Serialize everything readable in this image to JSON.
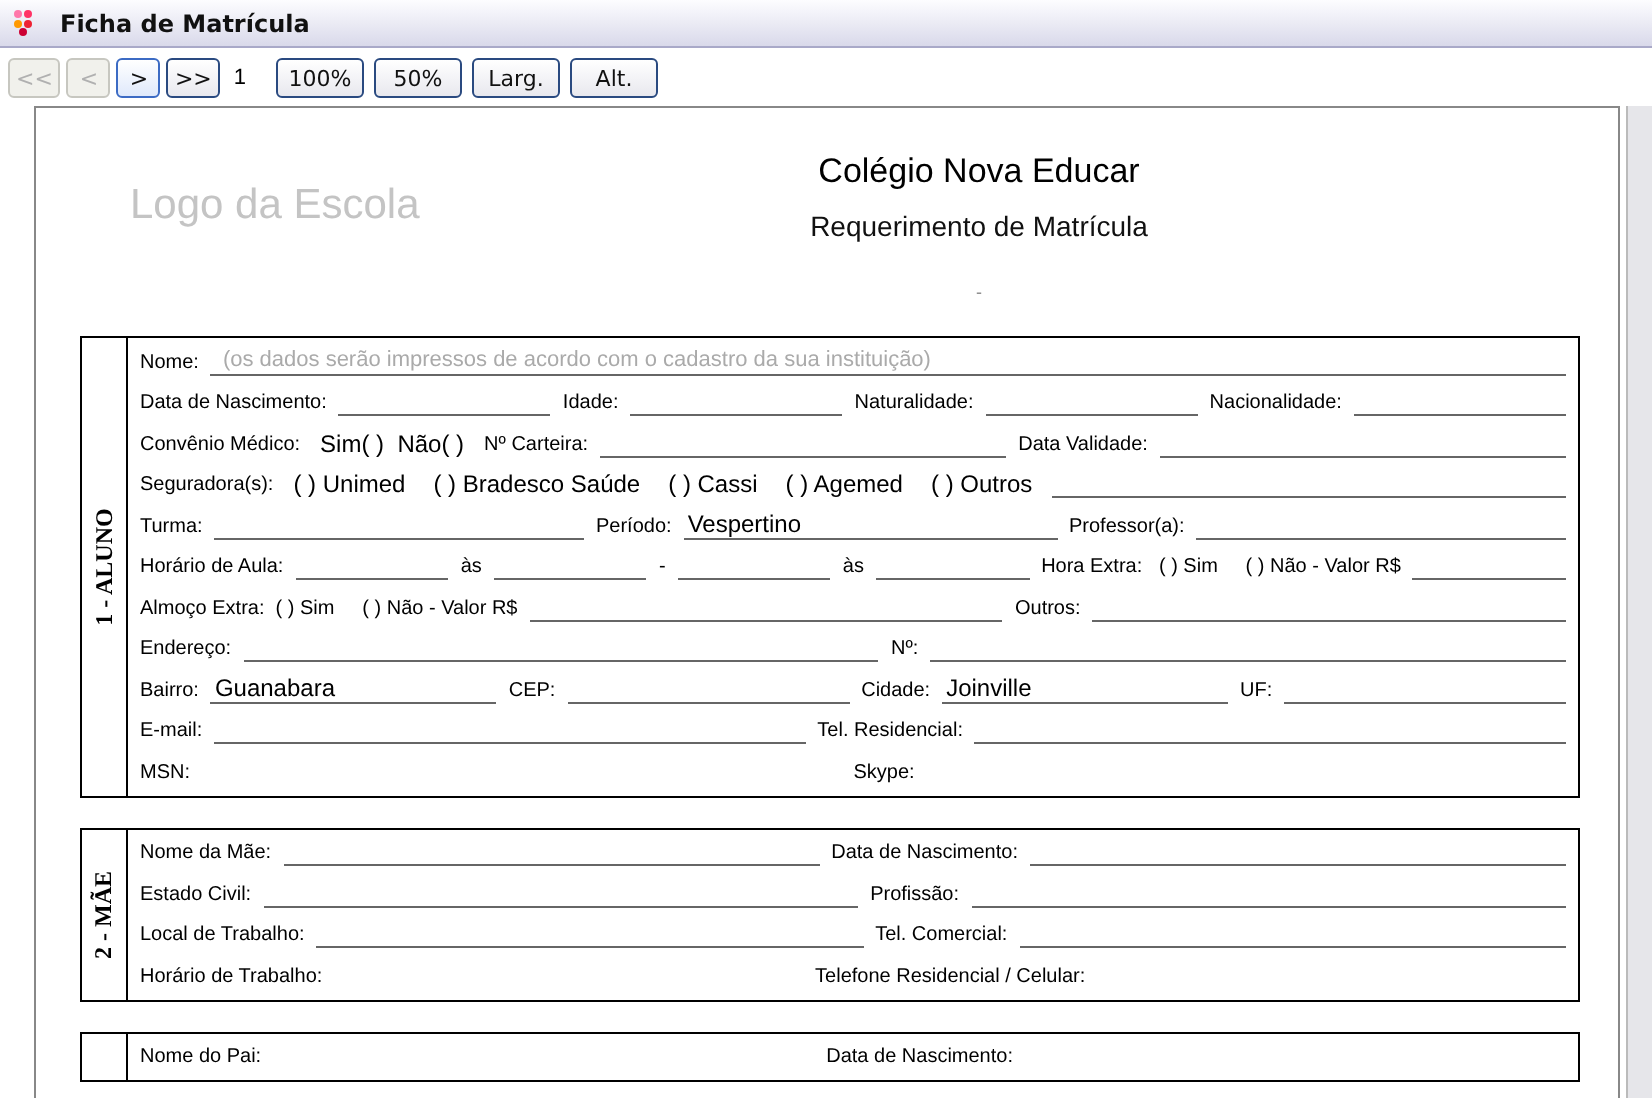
{
  "window": {
    "title": "Ficha de Matrícula"
  },
  "toolbar": {
    "nav_buttons": [
      {
        "label": "<<",
        "disabled": true
      },
      {
        "label": "<",
        "disabled": true
      },
      {
        "label": ">",
        "disabled": false,
        "selected": true
      },
      {
        "label": ">>",
        "disabled": false,
        "selected": false
      }
    ],
    "page": "1",
    "zoom_buttons": [
      "100%",
      "50%",
      "Larg.",
      "Alt."
    ]
  },
  "header": {
    "logo": "Logo da Escola",
    "school": "Colégio Nova Educar",
    "subtitle": "Requerimento de Matrícula",
    "mark": "-"
  },
  "sections": [
    {
      "title": "1 - ALUNO",
      "rows": [
        [
          {
            "kind": "label",
            "text": "Nome:"
          },
          {
            "kind": "hint",
            "text": "(os dados serão impressos de acordo com o cadastro da sua instituição)"
          }
        ],
        [
          {
            "kind": "label",
            "text": "Data de Nascimento:"
          },
          {
            "kind": "line"
          },
          {
            "kind": "label",
            "text": "Idade:"
          },
          {
            "kind": "line"
          },
          {
            "kind": "label",
            "text": "Naturalidade:"
          },
          {
            "kind": "line"
          },
          {
            "kind": "label",
            "text": "Nacionalidade:"
          },
          {
            "kind": "line"
          }
        ],
        [
          {
            "kind": "label",
            "text": "Convênio Médico:"
          },
          {
            "kind": "option",
            "text": "Sim( )  Não( )"
          },
          {
            "kind": "label",
            "text": "Nº Carteira:"
          },
          {
            "kind": "line"
          },
          {
            "kind": "label",
            "text": "Data Validade:"
          },
          {
            "kind": "line"
          }
        ],
        [
          {
            "kind": "label",
            "text": "Seguradora(s):"
          },
          {
            "kind": "option",
            "text": "( ) Unimed"
          },
          {
            "kind": "option",
            "text": "( ) Bradesco Saúde"
          },
          {
            "kind": "option",
            "text": "( ) Cassi"
          },
          {
            "kind": "option",
            "text": "( ) Agemed"
          },
          {
            "kind": "option",
            "text": "( ) Outros"
          },
          {
            "kind": "line"
          }
        ],
        [
          {
            "kind": "label",
            "text": "Turma:"
          },
          {
            "kind": "line"
          },
          {
            "kind": "label",
            "text": "Período:"
          },
          {
            "kind": "value",
            "text": "Vespertino"
          },
          {
            "kind": "label",
            "text": "Professor(a):"
          },
          {
            "kind": "line"
          }
        ],
        [
          {
            "kind": "label",
            "text": "Horário de Aula:"
          },
          {
            "kind": "line"
          },
          {
            "kind": "label",
            "text": "às"
          },
          {
            "kind": "line"
          },
          {
            "kind": "label",
            "text": "-"
          },
          {
            "kind": "line"
          },
          {
            "kind": "label",
            "text": "às"
          },
          {
            "kind": "line"
          },
          {
            "kind": "label",
            "text": "Hora Extra:   ( ) Sim     ( ) Não - Valor R$"
          },
          {
            "kind": "line"
          }
        ],
        [
          {
            "kind": "label",
            "text": "Almoço Extra:  ( ) Sim     ( ) Não - Valor R$"
          },
          {
            "kind": "line"
          },
          {
            "kind": "label",
            "text": "Outros:"
          },
          {
            "kind": "line"
          }
        ],
        [
          {
            "kind": "label",
            "text": "Endereço:"
          },
          {
            "kind": "line"
          },
          {
            "kind": "label",
            "text": "Nº:"
          },
          {
            "kind": "line"
          }
        ],
        [
          {
            "kind": "label",
            "text": "Bairro:"
          },
          {
            "kind": "value",
            "text": "Guanabara"
          },
          {
            "kind": "label",
            "text": "CEP:"
          },
          {
            "kind": "line"
          },
          {
            "kind": "label",
            "text": "Cidade:"
          },
          {
            "kind": "value",
            "text": "Joinville"
          },
          {
            "kind": "label",
            "text": "UF:"
          },
          {
            "kind": "line"
          }
        ],
        [
          {
            "kind": "label",
            "text": "E-mail:"
          },
          {
            "kind": "line"
          },
          {
            "kind": "label",
            "text": "Tel. Residencial:"
          },
          {
            "kind": "line"
          }
        ],
        [
          {
            "kind": "label",
            "text": "MSN:"
          },
          {
            "kind": "gap"
          },
          {
            "kind": "label",
            "text": "Skype:"
          },
          {
            "kind": "gap"
          }
        ]
      ]
    },
    {
      "title": "2 - MÃE",
      "rows": [
        [
          {
            "kind": "label",
            "text": "Nome da Mãe:"
          },
          {
            "kind": "line"
          },
          {
            "kind": "label",
            "text": "Data de Nascimento:"
          },
          {
            "kind": "line"
          }
        ],
        [
          {
            "kind": "label",
            "text": "Estado Civil:"
          },
          {
            "kind": "line"
          },
          {
            "kind": "label",
            "text": "Profissão:"
          },
          {
            "kind": "line"
          }
        ],
        [
          {
            "kind": "label",
            "text": "Local de Trabalho:"
          },
          {
            "kind": "line"
          },
          {
            "kind": "label",
            "text": "Tel. Comercial:"
          },
          {
            "kind": "line"
          }
        ],
        [
          {
            "kind": "label",
            "text": "Horário de Trabalho:"
          },
          {
            "kind": "gap"
          },
          {
            "kind": "label",
            "text": "Telefone Residencial / Celular:"
          },
          {
            "kind": "gap"
          }
        ]
      ]
    },
    {
      "rows": [
        [
          {
            "kind": "label",
            "text": "Nome do Pai:"
          },
          {
            "kind": "gap"
          },
          {
            "kind": "label",
            "text": "Data de Nascimento:"
          },
          {
            "kind": "gap"
          }
        ]
      ]
    }
  ]
}
